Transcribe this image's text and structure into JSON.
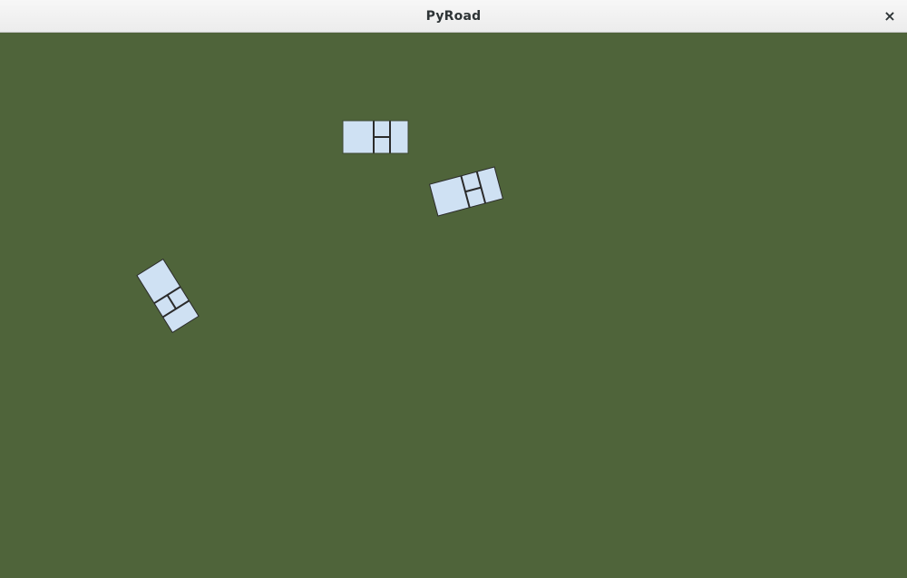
{
  "window": {
    "title": "PyRoad",
    "close_glyph": "×",
    "close_icon": "close-icon"
  },
  "scene": {
    "background_color": "#4f643a",
    "vehicle_color": "#cfe1f3",
    "vehicle_outline_color": "#2b2b2b",
    "vehicles": [
      {
        "id": "car-1"
      },
      {
        "id": "car-2"
      },
      {
        "id": "car-3"
      }
    ]
  }
}
